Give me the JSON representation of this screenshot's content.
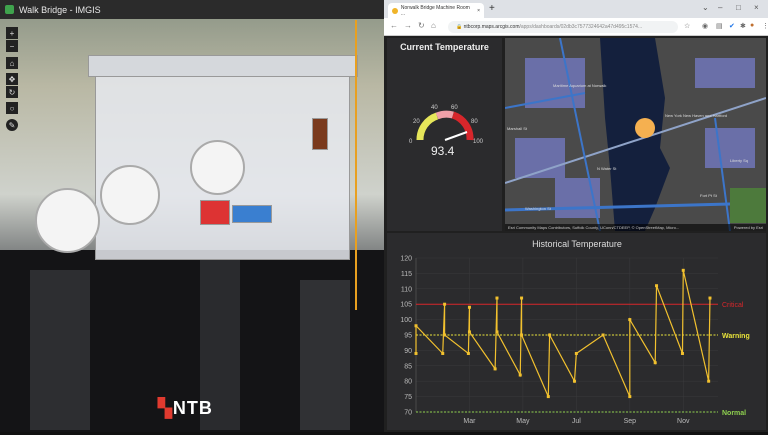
{
  "left_window": {
    "title": "Walk Bridge - IMGIS",
    "logo_text": "NTB",
    "tools": [
      "zoom-in",
      "zoom-out",
      "home",
      "pan",
      "orbit",
      "compass",
      "measure"
    ]
  },
  "browser": {
    "tab_title": "Norwalk Bridge Machine Room ...",
    "url_host": "ntbcorp.maps.arcgis.com",
    "url_path": "/apps/dashboards/02db3c7577324642a47d495c1574..."
  },
  "gauge": {
    "title": "Current Temperature",
    "value": "93.4",
    "min": 0,
    "max": 100,
    "ticks": [
      "0",
      "20",
      "40",
      "60",
      "80",
      "100"
    ],
    "colors": {
      "low": "#e6e65a",
      "mid": "#f0a0a8",
      "high": "#d7262b"
    }
  },
  "map": {
    "labels": [
      "Maritime Aquarium at Norwalk",
      "New York New Haven and Hartford",
      "Washington St",
      "Marshall St",
      "N Water St",
      "Liberty Sq",
      "Fort Pt St"
    ],
    "attribution": "Esri Community Maps Contributors, Suffolk County, UConn/CTDEEP, © OpenStreetMap, Micro...",
    "powered_by": "Powered by Esri",
    "marker_color": "#f5b050"
  },
  "chart_data": {
    "type": "line",
    "title": "Historical Temperature",
    "xlabel": "",
    "ylabel": "",
    "x_tick_labels": [
      {
        "label": "Mar",
        "x": 2
      },
      {
        "label": "May",
        "x": 4
      },
      {
        "label": "Jul",
        "x": 6
      },
      {
        "label": "Sep",
        "x": 8
      },
      {
        "label": "Nov",
        "x": 10
      }
    ],
    "xlim": [
      0,
      11.3
    ],
    "ylim": [
      70,
      120
    ],
    "y_ticks": [
      70,
      75,
      80,
      85,
      90,
      95,
      100,
      105,
      110,
      115,
      120
    ],
    "grid": true,
    "series": [
      {
        "name": "Temperature",
        "color": "#f2c12e",
        "x": [
          0,
          0,
          1.0,
          1.07,
          1.07,
          1.96,
          2.0,
          2.0,
          2.96,
          3.03,
          3.03,
          3.9,
          3.95,
          3.95,
          4.95,
          5.0,
          5.93,
          6.0,
          7.0,
          8.0,
          8.0,
          8.95,
          9.0,
          9.97,
          10.0,
          10.95,
          11.0
        ],
        "y": [
          89,
          98,
          89,
          105,
          95,
          89,
          104,
          96,
          84,
          107,
          96,
          82,
          107,
          95,
          75,
          95,
          80,
          89,
          95,
          75,
          100,
          86,
          111,
          89,
          116,
          80,
          107
        ]
      }
    ],
    "thresholds": [
      {
        "label": "Critical",
        "value": 105,
        "color": "#d7262b"
      },
      {
        "label": "Warning",
        "value": 95,
        "color": "#e8e33a"
      },
      {
        "label": "Normal",
        "value": 70,
        "color": "#8fd14f"
      }
    ]
  }
}
